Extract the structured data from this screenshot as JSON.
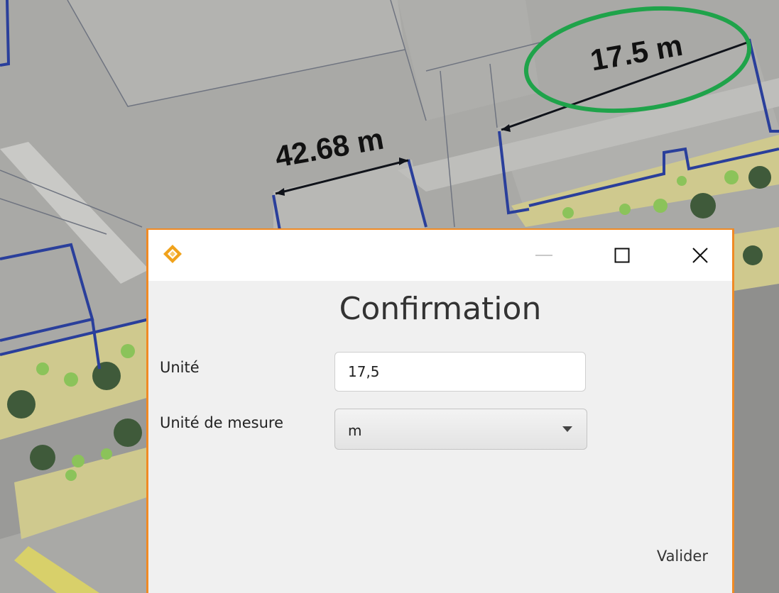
{
  "map": {
    "measurements": [
      {
        "label": "42.68 m"
      },
      {
        "label": "17.5 m"
      }
    ],
    "highlight_color": "#1fa34a",
    "plot_line_color": "#2a3f9b"
  },
  "dialog": {
    "logo": "app-logo-icon",
    "window_controls": {
      "minimize": "minimize-icon",
      "maximize": "maximize-icon",
      "close": "close-icon"
    },
    "title": "Confirmation",
    "fields": {
      "unit_label": "Unité",
      "unit_value": "17,5",
      "measure_label": "Unité de mesure",
      "measure_selected": "m"
    },
    "submit_label": "Valider",
    "accent_color": "#f08a24"
  }
}
